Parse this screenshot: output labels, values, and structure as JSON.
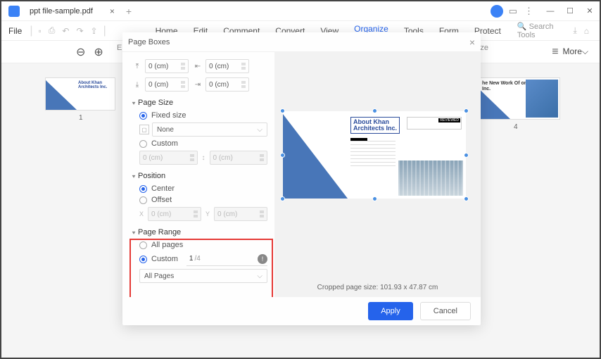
{
  "titlebar": {
    "tab_title": "ppt file-sample.pdf"
  },
  "menubar": {
    "file": "File",
    "items": [
      "Home",
      "Edit",
      "Comment",
      "Convert",
      "View",
      "Organize",
      "Tools",
      "Form",
      "Protect"
    ],
    "active_index": 5,
    "search": "Search Tools"
  },
  "toolbar": {
    "more": "More",
    "partial_left": "E",
    "partial_right": "ze"
  },
  "thumbs": {
    "left": {
      "num": "1",
      "title": "About Khan\nArchitects Inc."
    },
    "right": {
      "num": "4",
      "title": "he New Work Of\non Architects Inc."
    }
  },
  "dialog": {
    "title": "Page Boxes",
    "margins": {
      "top": "0 (cm)",
      "bottom": "0 (cm)",
      "left": "0 (cm)",
      "right": "0 (cm)"
    },
    "page_size": {
      "header": "Page Size",
      "fixed": "Fixed size",
      "none": "None",
      "custom": "Custom",
      "w": "0 (cm)",
      "h": "0 (cm)"
    },
    "position": {
      "header": "Position",
      "center": "Center",
      "offset": "Offset",
      "x": "0 (cm)",
      "y": "0 (cm)"
    },
    "range": {
      "header": "Page Range",
      "all": "All pages",
      "custom": "Custom",
      "value": "1",
      "suffix": "/4",
      "scope": "All Pages"
    },
    "preview": {
      "title": "About Khan\nArchitects Inc.",
      "badge": "REVIEWED"
    },
    "crop_info": "Cropped page size: 101.93 x 47.87 cm",
    "apply": "Apply",
    "cancel": "Cancel"
  }
}
